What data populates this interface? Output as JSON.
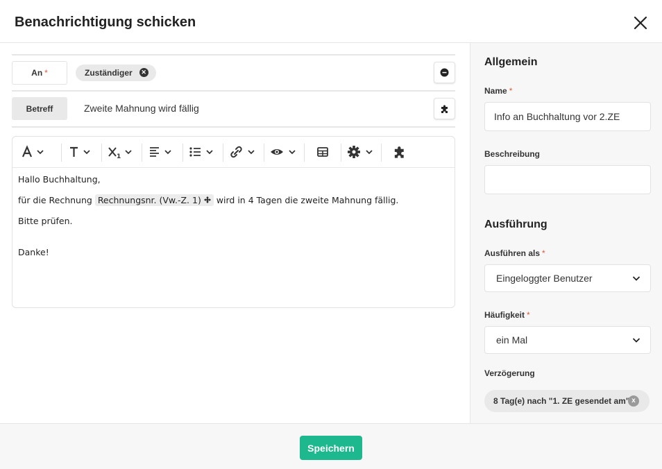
{
  "dialog": {
    "title": "Benachrichtigung schicken"
  },
  "recipients": {
    "label": "An",
    "required_marker": "*",
    "chips": [
      {
        "label": "Zuständiger"
      }
    ]
  },
  "subject": {
    "label": "Betreff",
    "value": "Zweite Mahnung wird fällig"
  },
  "editor": {
    "toolbar": [
      "font-color",
      "text-style",
      "sub-superscript",
      "align",
      "list",
      "link",
      "preview",
      "table",
      "settings",
      "plugin"
    ],
    "lines": {
      "greeting": "Hallo Buchhaltung,",
      "body_before": "für die Rechnung",
      "placeholder": "Rechnungsnr. (Vw.-Z. 1)",
      "body_after": "wird in 4 Tagen die zweite Mahnung fällig.",
      "check": "Bitte prüfen.",
      "thanks": "Danke!"
    }
  },
  "sidebar": {
    "general_heading": "Allgemein",
    "name_label": "Name",
    "name_value": "Info an Buchhaltung vor 2.ZE",
    "description_label": "Beschreibung",
    "description_value": "",
    "execution_heading": "Ausführung",
    "run_as_label": "Ausführen als",
    "run_as_value": "Eingeloggter Benutzer",
    "frequency_label": "Häufigkeit",
    "frequency_value": "ein Mal",
    "delay_label": "Verzögerung",
    "delay_chip": "8 Tag(e) nach \"1. ZE gesendet am\"",
    "required_marker": "*"
  },
  "footer": {
    "save_label": "Speichern"
  },
  "colors": {
    "accent": "#1db88e",
    "required": "#e05a3a"
  }
}
